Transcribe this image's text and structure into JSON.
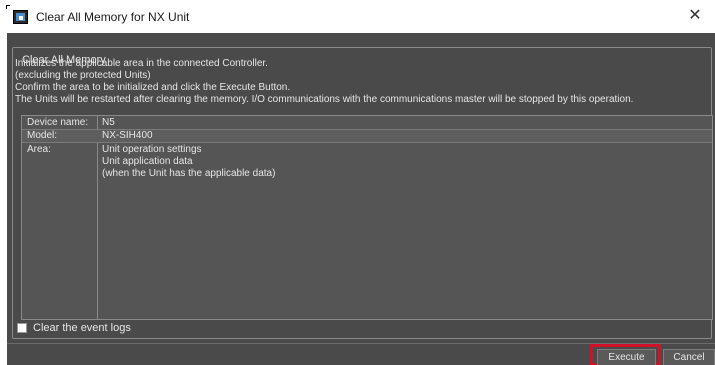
{
  "window": {
    "title": "Clear All Memory for NX Unit",
    "close_glyph": "✕"
  },
  "group": {
    "legend": "Clear All Memory",
    "description": [
      "Initializes the applicable area in the connected Controller.",
      "(excluding the protected Units)",
      "Confirm the area to be initialized and click the Execute Button.",
      "The Units will be restarted after clearing the memory. I/O communications with the communications master will be stopped by this operation."
    ]
  },
  "info": {
    "device_label": "Device name:",
    "device_value": "N5",
    "model_label": "Model:",
    "model_value": "NX-SIH400",
    "area_label": "Area:",
    "area_values": [
      "Unit operation settings",
      "Unit application data",
      "(when the Unit has the applicable data)"
    ]
  },
  "options": {
    "clear_event_logs_label": "Clear the event logs",
    "clear_event_logs_checked": false
  },
  "buttons": {
    "execute": "Execute",
    "cancel": "Cancel"
  },
  "colors": {
    "dialog_bg": "#4a4a4a",
    "highlight": "#d1112a"
  },
  "icons": {
    "app": "app-window-icon",
    "close": "close-icon"
  }
}
